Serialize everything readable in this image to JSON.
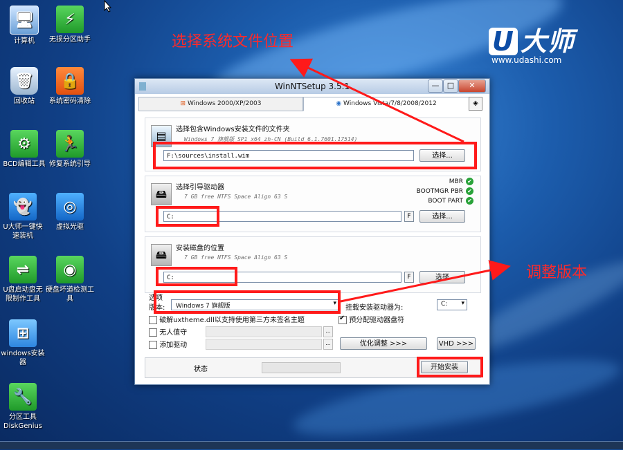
{
  "desktop": {
    "icons": [
      {
        "label": "计算机",
        "icon": "computer-icon"
      },
      {
        "label": "无损分区助手",
        "icon": "partition-icon"
      },
      {
        "label": "回收站",
        "icon": "recycle-bin-icon"
      },
      {
        "label": "系统密码清除",
        "icon": "lock-icon"
      },
      {
        "label": "BCD编辑工具",
        "icon": "gear-icon"
      },
      {
        "label": "修复系统引导",
        "icon": "runner-icon"
      },
      {
        "label": "U大师一键快速装机",
        "icon": "ghost-icon"
      },
      {
        "label": "虚拟光驱",
        "icon": "disc-icon"
      },
      {
        "label": "U盘启动盘无限制作工具",
        "icon": "usb-icon"
      },
      {
        "label": "硬盘坏道检测工具",
        "icon": "hdd-scan-icon"
      },
      {
        "label": "windows安装器",
        "icon": "windows-icon"
      },
      {
        "label": "分区工具DiskGenius",
        "icon": "wrench-icon"
      }
    ]
  },
  "brand": {
    "name": "大师",
    "prefix": "U",
    "url": "www.udashi.com"
  },
  "annotations": {
    "top": "选择系统文件位置",
    "right": "调整版本"
  },
  "window": {
    "title": "WinNTSetup 3.5.1",
    "controls": {
      "minimize": "—",
      "maximize": "□",
      "close": "✕"
    },
    "tabs": [
      {
        "label": "Windows 2000/XP/2003",
        "active": false
      },
      {
        "label": "Windows Vista/7/8/2008/2012",
        "active": true
      }
    ],
    "source": {
      "label": "选择包含Windows安装文件的文件夹",
      "info": "Windows 7 旗舰版 SP1 x64 zh-CN (Build 6.1.7601.17514)",
      "path": "F:\\sources\\install.wim",
      "button": "选择..."
    },
    "boot": {
      "label": "选择引导驱动器",
      "info": "7 GB free NTFS Space Align 63 S",
      "drive": "C:",
      "f_button": "F",
      "button": "选择...",
      "statuses": [
        {
          "label": "MBR"
        },
        {
          "label": "BOOTMGR PBR"
        },
        {
          "label": "BOOT PART"
        }
      ]
    },
    "install": {
      "label": "安装磁盘的位置",
      "info": "7 GB free NTFS Space Align 63 S",
      "drive": "C:",
      "f_button": "F",
      "button": "选择"
    },
    "options": {
      "group_label": "选项",
      "edition_label": "版本:",
      "edition_value": "Windows 7 旗舰版",
      "mount_label": "挂载安装驱动器为:",
      "mount_value": "C:",
      "checkboxes": [
        {
          "label": "破解uxtheme.dll以支持使用第三方未签名主题",
          "checked": false
        },
        {
          "label": "预分配驱动器盘符",
          "checked": true
        },
        {
          "label": "无人值守",
          "checked": false
        },
        {
          "label": "添加驱动",
          "checked": false
        }
      ],
      "tweak_button": "优化调整 >>>",
      "vhd_button": "VHD >>>",
      "ellipsis": "..."
    },
    "footer": {
      "status_label": "状态",
      "start_button": "开始安装"
    }
  }
}
